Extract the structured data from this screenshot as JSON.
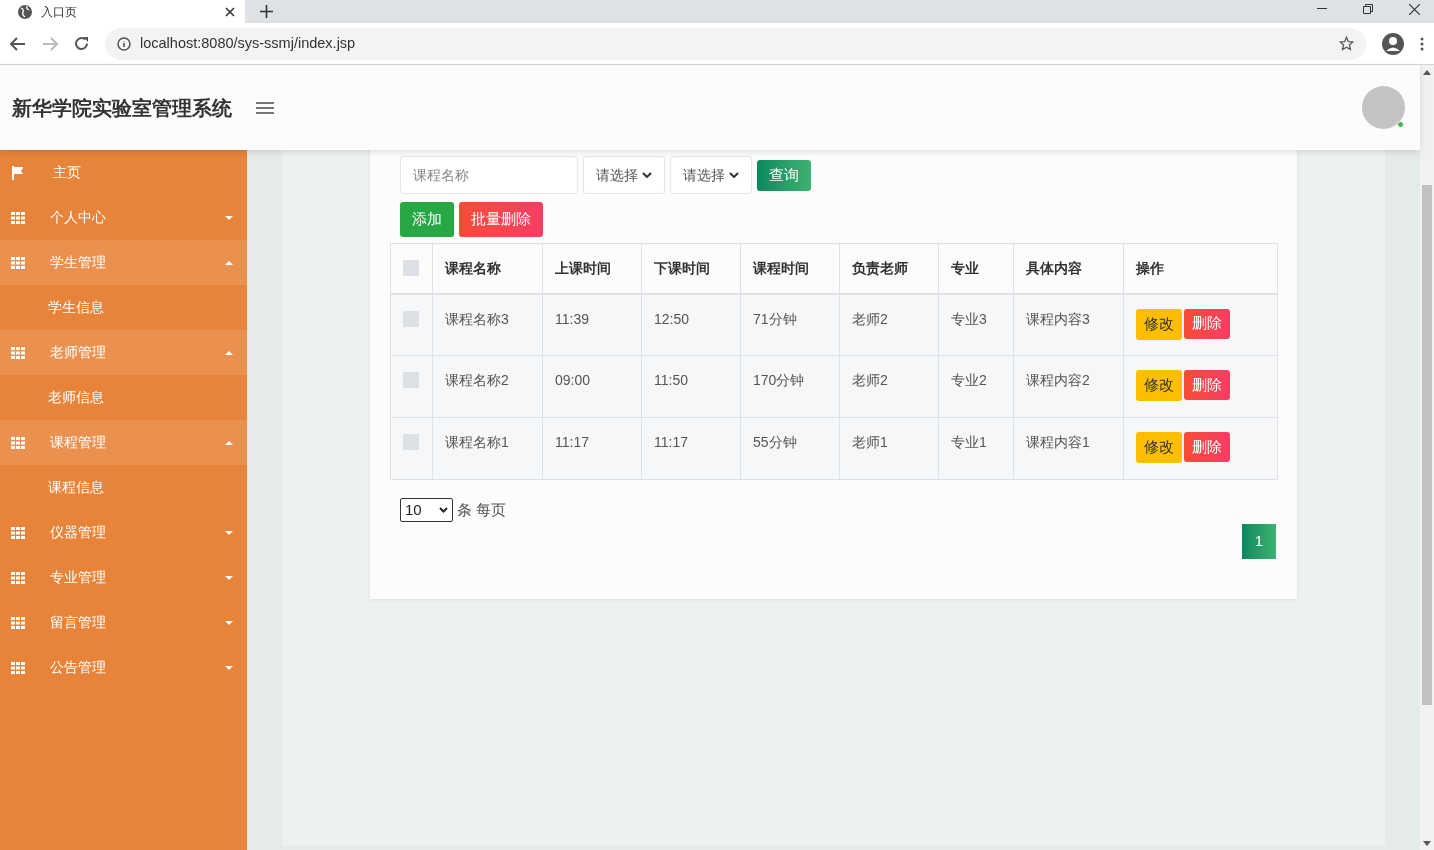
{
  "browser": {
    "tab_title": "入口页",
    "url": "localhost:8080/sys-ssmj/index.jsp"
  },
  "header": {
    "title": "新华学院实验室管理系统"
  },
  "sidebar": {
    "items": [
      {
        "label": "主页",
        "kind": "home",
        "expanded": false
      },
      {
        "label": "个人中心",
        "kind": "group",
        "expanded": false
      },
      {
        "label": "学生管理",
        "kind": "group",
        "expanded": true,
        "children": [
          {
            "label": "学生信息"
          }
        ]
      },
      {
        "label": "老师管理",
        "kind": "group",
        "expanded": true,
        "children": [
          {
            "label": "老师信息"
          }
        ]
      },
      {
        "label": "课程管理",
        "kind": "group",
        "expanded": true,
        "children": [
          {
            "label": "课程信息"
          }
        ]
      },
      {
        "label": "仪器管理",
        "kind": "group",
        "expanded": false
      },
      {
        "label": "专业管理",
        "kind": "group",
        "expanded": false
      },
      {
        "label": "留言管理",
        "kind": "group",
        "expanded": false
      },
      {
        "label": "公告管理",
        "kind": "group",
        "expanded": false
      }
    ]
  },
  "filters": {
    "search_placeholder": "课程名称",
    "selects": [
      "请选择",
      "请选择"
    ],
    "query_button": "查询"
  },
  "actions": {
    "add": "添加",
    "batch_delete": "批量删除"
  },
  "table": {
    "select_all_checked": false,
    "columns": [
      "课程名称",
      "上课时间",
      "下课时间",
      "课程时间",
      "负责老师",
      "专业",
      "具体内容",
      "操作"
    ],
    "rows": [
      {
        "checked": false,
        "cells": [
          "课程名称3",
          "11:39",
          "12:50",
          "71分钟",
          "老师2",
          "专业3",
          "课程内容3"
        ],
        "edit": "修改",
        "delete": "删除"
      },
      {
        "checked": false,
        "cells": [
          "课程名称2",
          "09:00",
          "11:50",
          "170分钟",
          "老师2",
          "专业2",
          "课程内容2"
        ],
        "edit": "修改",
        "delete": "删除"
      },
      {
        "checked": false,
        "cells": [
          "课程名称1",
          "11:17",
          "11:17",
          "55分钟",
          "老师1",
          "专业1",
          "课程内容1"
        ],
        "edit": "修改",
        "delete": "删除"
      }
    ]
  },
  "pagination": {
    "page_size": "10",
    "page_size_label": "条 每页",
    "pages": [
      {
        "label": "1",
        "selected": true
      }
    ]
  }
}
